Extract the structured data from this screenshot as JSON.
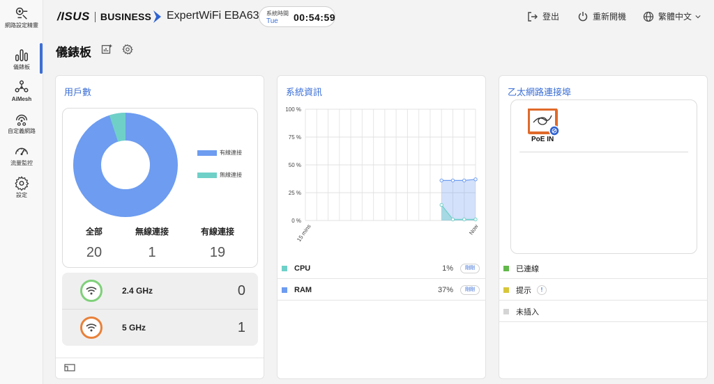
{
  "sidebar": {
    "items": [
      {
        "label": "網路設定精靈",
        "icon": "setup-wizard-icon"
      },
      {
        "label": "儀錶板",
        "icon": "dashboard-icon"
      },
      {
        "label": "AiMesh",
        "icon": "aimesh-icon"
      },
      {
        "label": "自定義網路",
        "icon": "custom-network-icon"
      },
      {
        "label": "流量監控",
        "icon": "traffic-monitor-icon"
      },
      {
        "label": "設定",
        "icon": "settings-icon"
      }
    ],
    "active": "儀錶板"
  },
  "header": {
    "brand_asus": "/ISUS",
    "brand_business": "BUSINESS",
    "model": "ExpertWiFi EBA63",
    "clock_label": "系統時間",
    "clock_day": "Tue",
    "clock_time": "00:54:59",
    "logout": "登出",
    "reboot": "重新開機",
    "language": "繁體中文"
  },
  "page": {
    "title": "儀錶板"
  },
  "clients": {
    "title": "用戶數",
    "legend_wired": "有線連接",
    "legend_wireless": "無線連接",
    "total_label": "全部",
    "total": 20,
    "wireless_label": "無線連接",
    "wireless": 1,
    "wired_label": "有線連接",
    "wired": 19,
    "bands": [
      {
        "name": "2.4 GHz",
        "count": 0,
        "color": "#7fd07a"
      },
      {
        "name": "5 GHz",
        "count": 1,
        "color": "#e8813a"
      }
    ]
  },
  "system": {
    "title": "系統資訊",
    "y_ticks": [
      "100 %",
      "75 %",
      "50 %",
      "25 %",
      "0 %"
    ],
    "x_ticks": [
      "15 mins",
      "Now"
    ],
    "rows": [
      {
        "name": "CPU",
        "value": "1%",
        "pill": "剛剛",
        "color": "#6fd0c8"
      },
      {
        "name": "RAM",
        "value": "37%",
        "pill": "剛剛",
        "color": "#6d9cf0"
      }
    ]
  },
  "chart_data": {
    "type": "area",
    "x": [
      1,
      2,
      3,
      4
    ],
    "series": [
      {
        "name": "RAM",
        "values": [
          36,
          36,
          36,
          37
        ]
      },
      {
        "name": "CPU",
        "values": [
          14,
          1,
          1,
          1
        ]
      }
    ],
    "ylim": [
      0,
      100
    ],
    "x_tick_labels": [
      "15 mins",
      "Now"
    ],
    "grid": true
  },
  "ethernet": {
    "title": "乙太網路連接埠",
    "port_label": "PoE IN",
    "statuses": [
      {
        "label": "已連線",
        "color": "#62b84a"
      },
      {
        "label": "提示",
        "color": "#d8c63a",
        "badge": "!"
      },
      {
        "label": "未插入",
        "color": "#d4d4d4"
      }
    ]
  },
  "colors": {
    "accent": "#3b6fd6",
    "wired": "#6d9cf0",
    "wireless": "#6fd0c8",
    "port_orange": "#e06a2a"
  }
}
